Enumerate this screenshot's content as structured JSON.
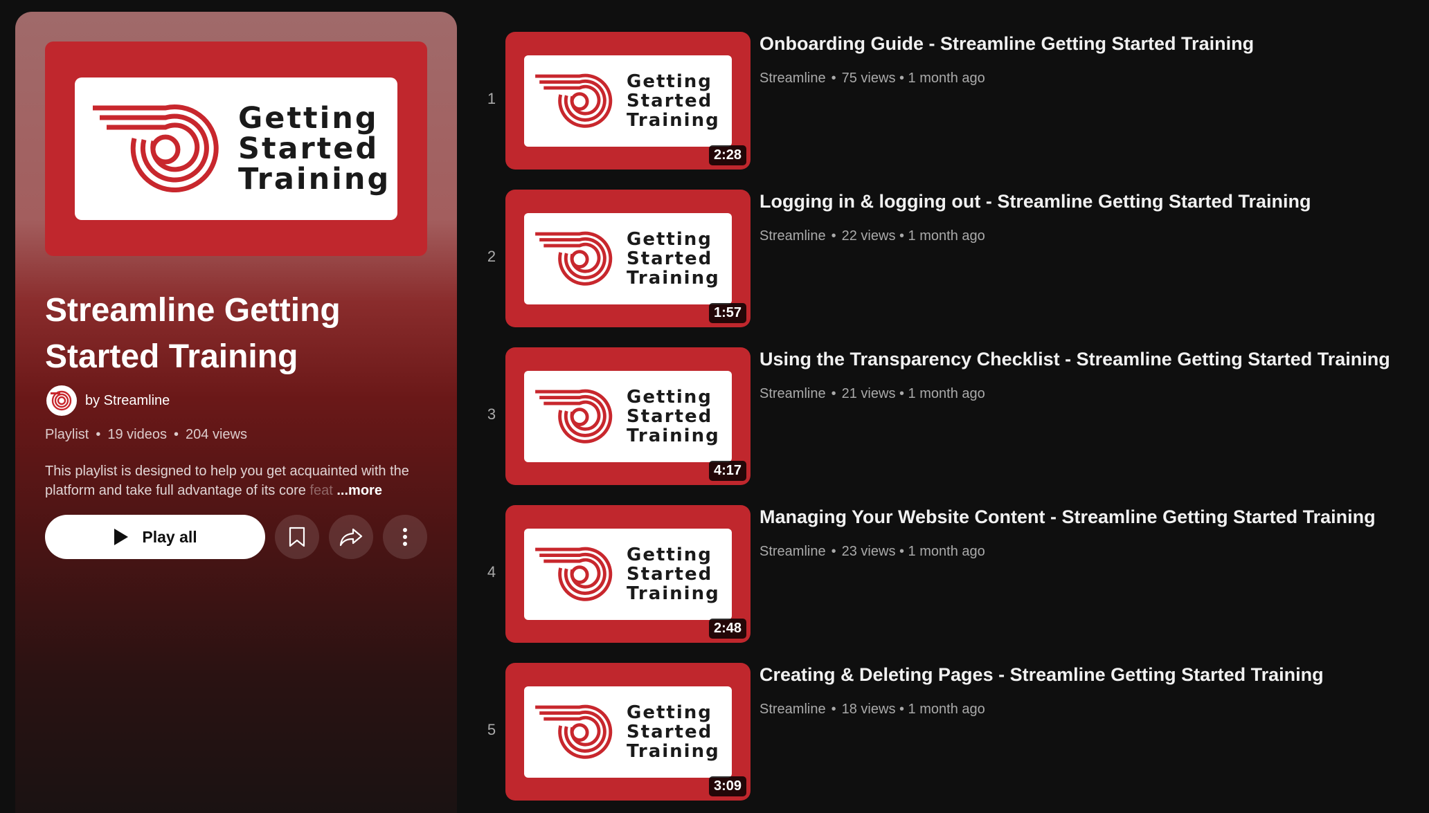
{
  "playlist": {
    "thumb_text": [
      "Getting",
      "Started",
      "Training"
    ],
    "title": "Streamline Getting Started Training",
    "owner": "by Streamline",
    "type": "Playlist",
    "videos": "19 videos",
    "views": "204 views",
    "description": "This playlist is designed to help you get acquainted with the platform and take full advantage of its core",
    "description_fade": " feat",
    "more": "...more",
    "play_all": "Play all"
  },
  "videos": [
    {
      "index": "1",
      "title": "Onboarding Guide - Streamline Getting Started Training",
      "channel": "Streamline",
      "stats": "75 views • 1 month ago",
      "duration": "2:28"
    },
    {
      "index": "2",
      "title": "Logging in & logging out - Streamline Getting Started Training",
      "channel": "Streamline",
      "stats": "22 views • 1 month ago",
      "duration": "1:57"
    },
    {
      "index": "3",
      "title": "Using the Transparency Checklist - Streamline Getting Started Training",
      "channel": "Streamline",
      "stats": "21 views • 1 month ago",
      "duration": "4:17"
    },
    {
      "index": "4",
      "title": "Managing Your Website Content - Streamline Getting Started Training",
      "channel": "Streamline",
      "stats": "23 views • 1 month ago",
      "duration": "2:48"
    },
    {
      "index": "5",
      "title": "Creating & Deleting Pages - Streamline Getting Started Training",
      "channel": "Streamline",
      "stats": "18 views • 1 month ago",
      "duration": "3:09"
    }
  ],
  "icons": {
    "play": "play-icon",
    "save": "bookmark-icon",
    "share": "share-icon",
    "more": "more-vert-icon",
    "logo": "streamline-logo-icon"
  },
  "colors": {
    "brand_red": "#c0272d",
    "background": "#0f0f0f"
  }
}
